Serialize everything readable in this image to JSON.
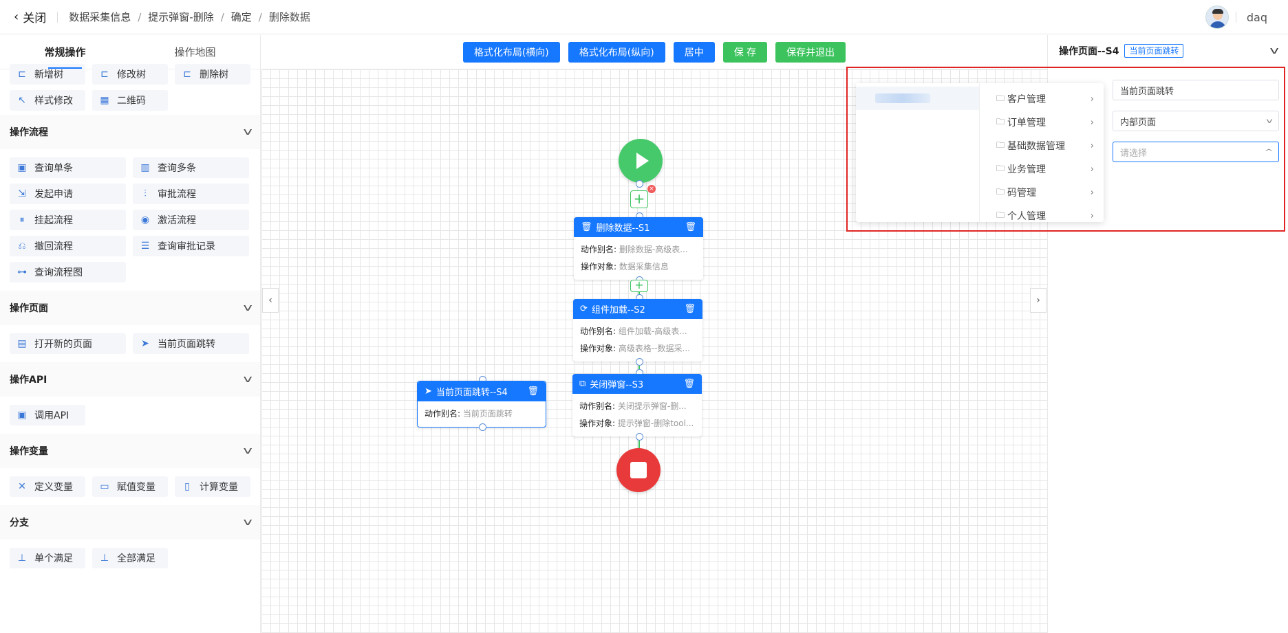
{
  "topbar": {
    "close_label": "关闭",
    "breadcrumbs": [
      "数据采集信息",
      "提示弹窗-删除",
      "确定",
      "删除数据"
    ],
    "user_name": "daq"
  },
  "left": {
    "tabs": [
      "常规操作",
      "操作地图"
    ],
    "top_buttons": [
      {
        "label": "新增树",
        "icon": "tree-add-icon"
      },
      {
        "label": "修改树",
        "icon": "tree-edit-icon"
      },
      {
        "label": "删除树",
        "icon": "tree-delete-icon"
      },
      {
        "label": "样式修改",
        "icon": "pointer-icon"
      },
      {
        "label": "二维码",
        "icon": "qrcode-icon"
      }
    ],
    "sections": {
      "flow": {
        "title": "操作流程",
        "items": [
          "查询单条",
          "查询多条",
          "发起申请",
          "审批流程",
          "挂起流程",
          "激活流程",
          "撤回流程",
          "查询审批记录",
          "查询流程图"
        ]
      },
      "page": {
        "title": "操作页面",
        "items": [
          "打开新的页面",
          "当前页面跳转"
        ]
      },
      "api": {
        "title": "操作API",
        "items": [
          "调用API"
        ]
      },
      "var": {
        "title": "操作变量",
        "items": [
          "定义变量",
          "赋值变量",
          "计算变量"
        ]
      },
      "branch": {
        "title": "分支",
        "items": [
          "单个满足",
          "全部满足"
        ]
      }
    }
  },
  "toolbar": {
    "layout_h": "格式化布局(横向)",
    "layout_v": "格式化布局(纵向)",
    "center": "居中",
    "save": "保 存",
    "save_exit": "保存并退出"
  },
  "nodes": {
    "s1": {
      "title": "删除数据--S1",
      "alias_label": "动作别名:",
      "alias": "删除数据-高级表...",
      "target_label": "操作对象:",
      "target": "数据采集信息"
    },
    "s2": {
      "title": "组件加载--S2",
      "alias_label": "动作别名:",
      "alias": "组件加载-高级表...",
      "target_label": "操作对象:",
      "target": "高级表格--数据采..."
    },
    "s3": {
      "title": "关闭弹窗--S3",
      "alias_label": "动作别名:",
      "alias": "关闭提示弹窗-删...",
      "target_label": "操作对象:",
      "target": "提示弹窗-删除tool..."
    },
    "s4": {
      "title": "当前页面跳转--S4",
      "alias_label": "动作别名:",
      "alias": "当前页面跳转"
    }
  },
  "cascader": {
    "items": [
      "客户管理",
      "订单管理",
      "基础数据管理",
      "业务管理",
      "码管理",
      "个人管理"
    ]
  },
  "right": {
    "title": "操作页面--S4",
    "tag": "当前页面跳转",
    "field_alias": "当前页面跳转",
    "field_type": "内部页面",
    "field_select_placeholder": "请选择"
  },
  "colors": {
    "primary": "#1677ff",
    "success": "#3cc35e",
    "danger": "#e83a3a",
    "highlight": "#e02424"
  }
}
